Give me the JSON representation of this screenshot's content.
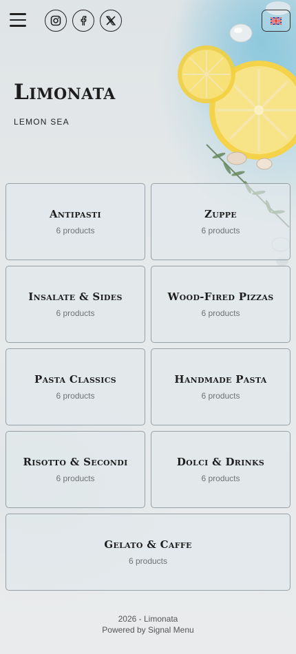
{
  "header": {
    "menu_icon": "hamburger-menu-icon",
    "social": [
      {
        "name": "instagram",
        "icon": "instagram-icon"
      },
      {
        "name": "facebook",
        "icon": "facebook-icon"
      },
      {
        "name": "x",
        "icon": "x-twitter-icon"
      }
    ],
    "language_flag": "uk-flag-icon"
  },
  "hero": {
    "title": "Limonata",
    "subtitle": "LEMON SEA"
  },
  "categories": [
    {
      "name": "Antipasti",
      "count": "6 products"
    },
    {
      "name": "Zuppe",
      "count": "6 products"
    },
    {
      "name": "Insalate & Sides",
      "count": "6 products"
    },
    {
      "name": "Wood-Fired Pizzas",
      "count": "6 products"
    },
    {
      "name": "Pasta Classics",
      "count": "6 products"
    },
    {
      "name": "Handmade Pasta",
      "count": "6 products"
    },
    {
      "name": "Risotto & Secondi",
      "count": "6 products"
    },
    {
      "name": "Dolci & Drinks",
      "count": "6 products"
    },
    {
      "name": "Gelato & Caffe",
      "count": "6 products"
    }
  ],
  "footer": {
    "copyright": "2026 - Limonata",
    "powered_by": "Powered by Signal Menu"
  },
  "colors": {
    "text_dark": "#1d1d1d",
    "muted": "#6d7275",
    "card_border": "#5a6469",
    "sea_blue": "#46aad2",
    "lemon_yellow": "#f5d23c"
  }
}
